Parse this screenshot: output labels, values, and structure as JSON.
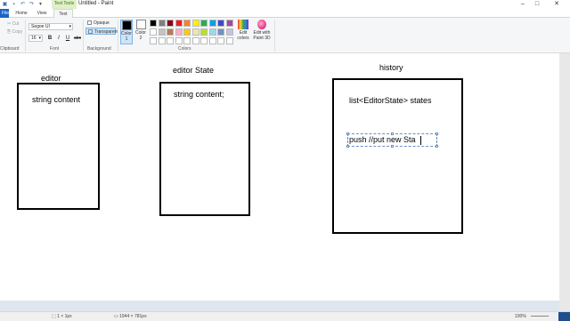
{
  "window": {
    "title": "Untitled - Paint",
    "context_tab": "Text Tools",
    "controls": {
      "minimize": "–",
      "maximize": "□",
      "close": "✕"
    }
  },
  "ribbon_tabs": {
    "file": "File",
    "home": "Home",
    "view": "View",
    "text": "Text"
  },
  "clipboard": {
    "cut": "Cut",
    "copy": "Copy",
    "label": "Clipboard"
  },
  "font": {
    "family": "Segoe UI",
    "size": "16",
    "bold": "B",
    "italic": "I",
    "underline": "U",
    "strike": "abc",
    "label": "Font"
  },
  "background": {
    "opaque": "Opaque",
    "transparent": "Transparent",
    "label": "Background"
  },
  "colors": {
    "color1_label": "Color 1",
    "color2_label": "Color 2",
    "color1": "#000000",
    "color2": "#ffffff",
    "edit_colors": "Edit colors",
    "edit_paint3d": "Edit with Paint 3D",
    "label": "Colors",
    "palette_row1": [
      "#000000",
      "#7f7f7f",
      "#880015",
      "#ed1c24",
      "#ff7f27",
      "#fff200",
      "#22b14c",
      "#00a2e8",
      "#3f48cc",
      "#a349a4"
    ],
    "palette_row2": [
      "#ffffff",
      "#c3c3c3",
      "#b97a57",
      "#ffaec9",
      "#ffc90e",
      "#efe4b0",
      "#b5e61d",
      "#99d9ea",
      "#7092be",
      "#c8bfe7"
    ],
    "palette_row3": [
      "#ffffff",
      "#ffffff",
      "#ffffff",
      "#ffffff",
      "#ffffff",
      "#ffffff",
      "#ffffff",
      "#ffffff",
      "#ffffff",
      "#ffffff"
    ]
  },
  "canvas": {
    "editor_title": "editor",
    "editor_content": "string content",
    "state_title": "editor State",
    "state_content": "string content;",
    "history_title": "history",
    "history_content": "list<EditorState> states",
    "typing_text": "push //put new Sta"
  },
  "status": {
    "selection": "1 × 1px",
    "size": "1944 × 781px",
    "zoom": "100%"
  }
}
